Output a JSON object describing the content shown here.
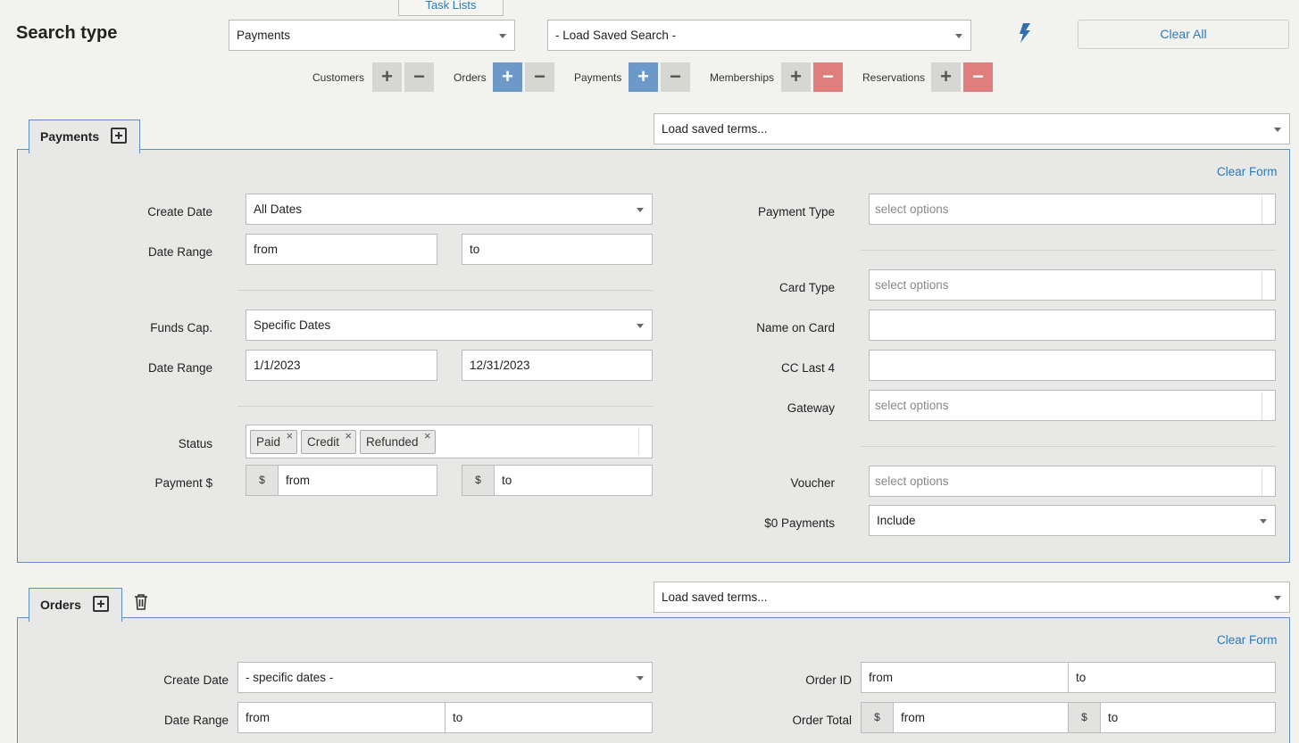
{
  "header": {
    "task_lists": "Task Lists",
    "search_type_label": "Search type",
    "search_type_value": "Payments",
    "saved_search_value": "- Load Saved Search -",
    "clear_all": "Clear All"
  },
  "toggles": [
    {
      "label": "Customers",
      "plus": "+",
      "minus": "−"
    },
    {
      "label": "Orders",
      "plus": "+",
      "minus": "−"
    },
    {
      "label": "Payments",
      "plus": "+",
      "minus": "−"
    },
    {
      "label": "Memberships",
      "plus": "+",
      "minus": "−"
    },
    {
      "label": "Reservations",
      "plus": "+",
      "minus": "−"
    }
  ],
  "payments": {
    "tab_label": "Payments",
    "saved_terms": "Load saved terms...",
    "clear_form": "Clear Form",
    "create_date_label": "Create Date",
    "create_date_value": "All Dates",
    "date_range_label": "Date Range",
    "date_range_from": "from",
    "date_range_to": "to",
    "funds_cap_label": "Funds Cap.",
    "funds_cap_value": "Specific Dates",
    "date_range2_label": "Date Range",
    "date_range2_from": "1/1/2023",
    "date_range2_to": "12/31/2023",
    "status_label": "Status",
    "status_chips": [
      "Paid",
      "Credit",
      "Refunded"
    ],
    "chip_remove": "×",
    "payment_label": "Payment $",
    "currency": "$",
    "payment_from": "from",
    "payment_to": "to",
    "payment_type_label": "Payment Type",
    "card_type_label": "Card Type",
    "name_on_card_label": "Name on Card",
    "cc_last4_label": "CC Last 4",
    "gateway_label": "Gateway",
    "voucher_label": "Voucher",
    "zero_payments_label": "$0 Payments",
    "zero_payments_value": "Include",
    "select_placeholder": "select options"
  },
  "orders": {
    "tab_label": "Orders",
    "saved_terms": "Load saved terms...",
    "clear_form": "Clear Form",
    "create_date_label": "Create Date",
    "create_date_value": "- specific dates -",
    "date_range_label": "Date Range",
    "date_range_from": "from",
    "date_range_to": "to",
    "order_id_label": "Order ID",
    "order_id_from": "from",
    "order_id_to": "to",
    "order_total_label": "Order Total",
    "currency": "$",
    "order_total_from": "from",
    "order_total_to": "to"
  }
}
